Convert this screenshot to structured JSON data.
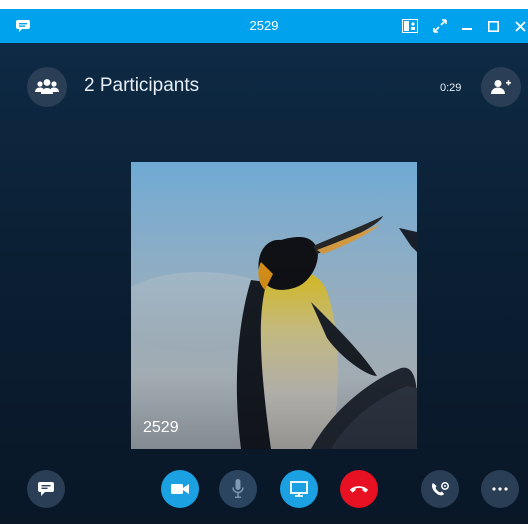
{
  "titlebar": {
    "title": "2529",
    "icons": [
      "chat-icon",
      "compact-view-icon",
      "full-screen-icon",
      "minimize-icon",
      "maximize-icon",
      "close-icon"
    ]
  },
  "header": {
    "participants_label": "2 Participants",
    "call_timer": "0:29",
    "icons": [
      "participants-icon",
      "add-person-icon"
    ]
  },
  "video": {
    "caller_name": "2529"
  },
  "controls": {
    "icons": [
      "chat-icon",
      "video-icon",
      "microphone-icon",
      "present-icon",
      "hang-up-icon",
      "call-controls-icon",
      "more-options-icon"
    ]
  },
  "colors": {
    "titlebar": "#00a2ed",
    "accent_button": "#1ba1e2",
    "hangup": "#e81123",
    "background": "#0d2033"
  }
}
